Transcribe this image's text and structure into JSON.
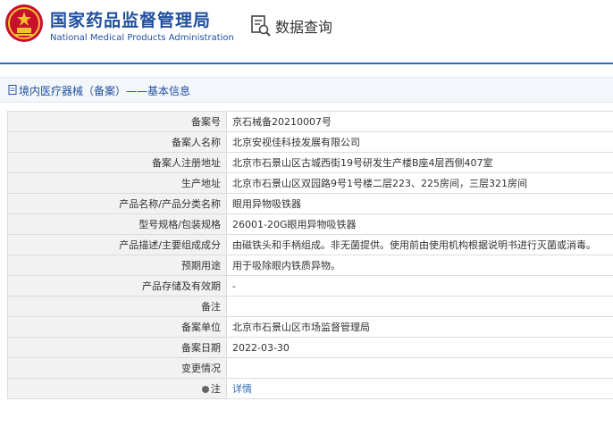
{
  "header": {
    "org_name_cn": "国家药品监督管理局",
    "org_name_en": "National Medical Products Administration",
    "emblem_icon": "national-emblem-icon",
    "search_label": "数据查询",
    "search_icon": "document-search-icon"
  },
  "breadcrumb": {
    "part1": "境内医疗器械（备案）",
    "separator": "——",
    "part2": "基本信息"
  },
  "colors": {
    "brand_blue": "#1f4f9f",
    "link_blue": "#2f6db5",
    "label_bg": "#f2f2f2"
  },
  "rows": [
    {
      "label": "备案号",
      "value": "京石械备20210007号"
    },
    {
      "label": "备案人名称",
      "value": "北京安视佳科技发展有限公司"
    },
    {
      "label": "备案人注册地址",
      "value": "北京市石景山区古城西街19号研发生产楼B座4层西侧407室"
    },
    {
      "label": "生产地址",
      "value": "北京市石景山区双园路9号1号楼二层223、225房间，三层321房间"
    },
    {
      "label": "产品名称/产品分类名称",
      "value": "眼用异物吸铁器"
    },
    {
      "label": "型号规格/包装规格",
      "value": "26001-20G眼用异物吸铁器"
    },
    {
      "label": "产品描述/主要组成成分",
      "value": "由磁铁头和手柄组成。非无菌提供。使用前由使用机构根据说明书进行灭菌或消毒。"
    },
    {
      "label": "预期用途",
      "value": "用于吸除眼内铁质异物。"
    },
    {
      "label": "产品存储及有效期",
      "value": "-"
    },
    {
      "label": "备注",
      "value": ""
    },
    {
      "label": "备案单位",
      "value": "北京市石景山区市场监督管理局"
    },
    {
      "label": "备案日期",
      "value": "2022-03-30"
    },
    {
      "label": "变更情况",
      "value": ""
    }
  ],
  "note_row": {
    "label": "注",
    "link": "详情"
  }
}
